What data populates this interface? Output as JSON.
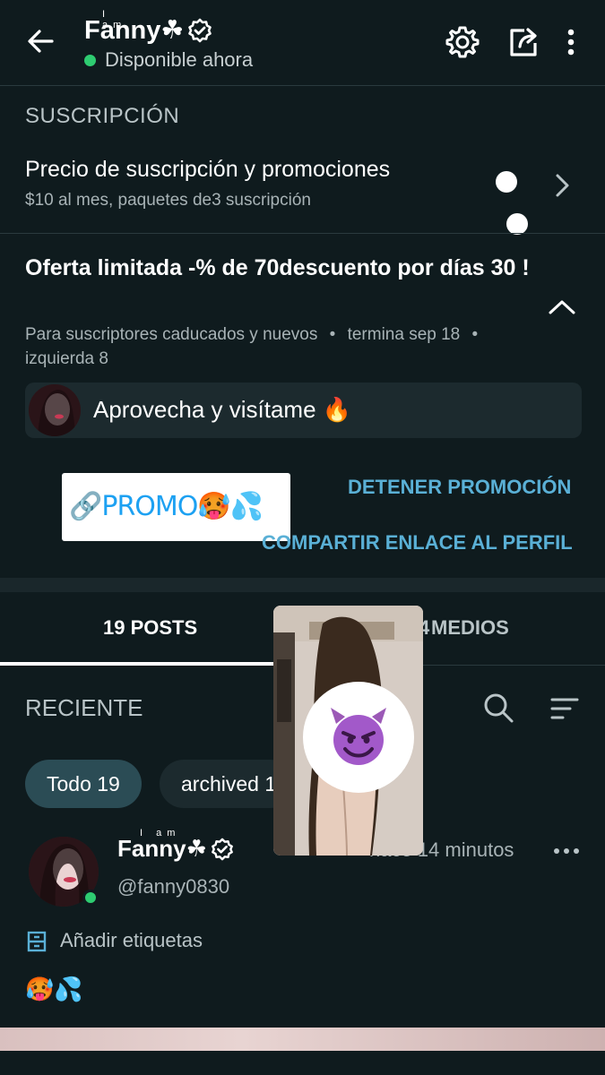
{
  "header": {
    "name_super": "I am",
    "name": "Fanny☘",
    "status": "Disponible ahora"
  },
  "subscription": {
    "section_title": "SUSCRIPCIÓN",
    "row_title": "Precio de suscripción y promociones",
    "row_subtitle": "$10 al mes, paquetes de3 suscripción"
  },
  "offer": {
    "title": "Oferta limitada -% de 70descuento por días 30 !",
    "meta_audience": "Para suscriptores caducados y nuevos",
    "meta_ends": "termina sep 18",
    "meta_left": "izquierda 8",
    "message": "Aprovecha y visítame 🔥",
    "promo_sticker": "🔗PROMO🥵💦",
    "stop_promo": "DETENER PROMOCIÓN",
    "share_link": "COMPARTIR ENLACE AL PERFIL"
  },
  "tabs": {
    "posts": "19 POSTS",
    "media": "MEDIOS",
    "media_count_partial": "4"
  },
  "feed": {
    "section": "RECIENTE",
    "chips": [
      {
        "label": "Todo 19"
      },
      {
        "label": "archived 1"
      }
    ]
  },
  "post": {
    "name_super": "I am",
    "name": "Fanny☘",
    "handle": "@fanny0830",
    "time": "hace 14 minutos",
    "tags_label": "Añadir etiquetas",
    "body": "🥵💦"
  },
  "colors": {
    "background": "#0f1b1e",
    "accent": "#5ab0d6",
    "online": "#2ecc71"
  }
}
